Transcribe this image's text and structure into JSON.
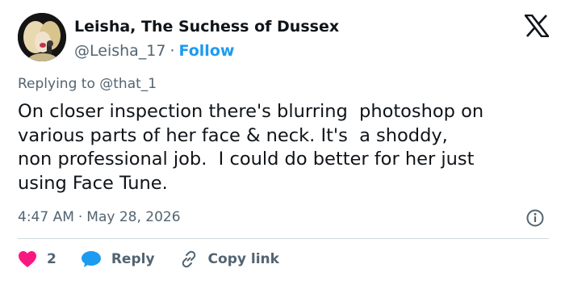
{
  "header": {
    "display_name": "Leisha, The Suchess of Dussex",
    "handle": "@Leisha_17",
    "separator": "·",
    "follow_label": "Follow"
  },
  "reply": {
    "prefix": "Replying to",
    "mention": "@that_1"
  },
  "tweet": {
    "text": "On closer inspection there's blurring  photoshop on\nvarious parts of her face & neck. It's  a shoddy,\nnon professional job.  I could do better for her just\nusing Face Tune."
  },
  "meta": {
    "time": "4:47 AM",
    "separator": "·",
    "date": "May 28, 2026"
  },
  "actions": {
    "like_count": "2",
    "reply_label": "Reply",
    "copy_link_label": "Copy link"
  },
  "icons": {
    "logo": "x-logo-icon",
    "info": "info-icon",
    "like": "heart-icon",
    "reply": "speech-bubble-icon",
    "copy_link": "link-icon"
  },
  "colors": {
    "text": "#0f1419",
    "secondary": "#536471",
    "follow": "#1d9bf0",
    "like": "#f91880",
    "reply_bubble": "#1d9bf0",
    "divider": "#cfd9de"
  }
}
